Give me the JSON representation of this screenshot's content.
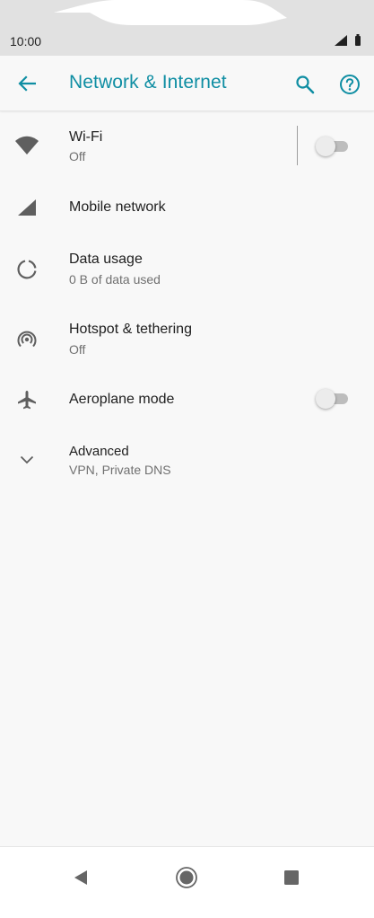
{
  "status_bar": {
    "time": "10:00"
  },
  "app_bar": {
    "title": "Network & Internet"
  },
  "items": [
    {
      "title": "Wi-Fi",
      "subtitle": "Off",
      "icon": "wifi-icon",
      "toggle": "off"
    },
    {
      "title": "Mobile network",
      "icon": "signal-icon"
    },
    {
      "title": "Data usage",
      "subtitle": "0 B of data used",
      "icon": "data-usage-icon"
    },
    {
      "title": "Hotspot & tethering",
      "subtitle": "Off",
      "icon": "hotspot-icon"
    },
    {
      "title": "Aeroplane mode",
      "icon": "airplane-icon",
      "toggle": "off"
    },
    {
      "title": "Advanced",
      "subtitle": "VPN, Private DNS",
      "icon": "chevron-down-icon"
    }
  ],
  "colors": {
    "accent": "#0f8ea3",
    "background": "#f8f8f8",
    "icon": "#5f5f5f"
  }
}
